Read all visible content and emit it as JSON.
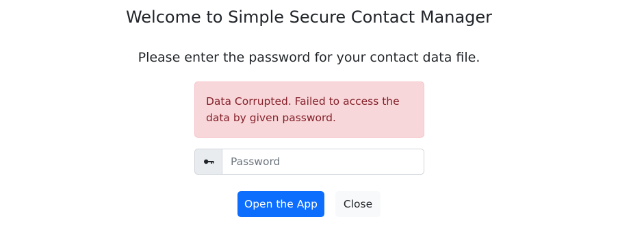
{
  "header": {
    "title": "Welcome to Simple Secure Contact Manager",
    "subtitle": "Please enter the password for your contact data file."
  },
  "alert": {
    "message": "Data Corrupted. Failed to access the data by given password.",
    "color": "#842029",
    "background": "#f8d7da"
  },
  "password": {
    "icon": "key-icon",
    "placeholder": "Password",
    "value": ""
  },
  "buttons": {
    "open_label": "Open the App",
    "close_label": "Close",
    "primary_color": "#0d6efd"
  }
}
